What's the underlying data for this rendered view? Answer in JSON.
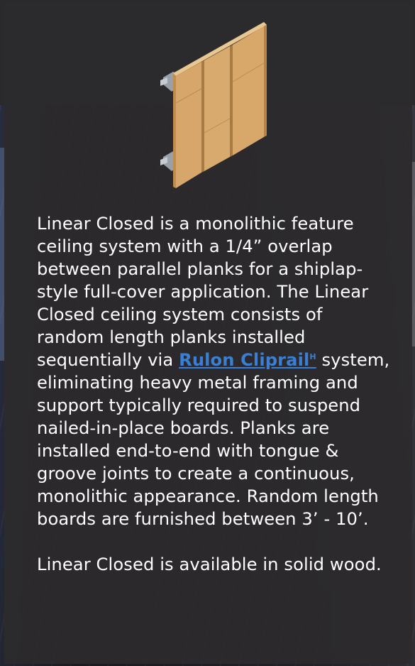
{
  "product": {
    "name": "Linear Closed",
    "image_icon": "wood-plank-panel-icon"
  },
  "description": {
    "para1_part1": "Linear Closed is a monolithic feature ceiling system with a 1/4” overlap between parallel planks for a shiplap-style full-cover application. The Linear Closed ceiling system consists of random length planks installed sequentially via ",
    "link_label": "Rulon Cliprail",
    "link_sup": "H",
    "para1_part2": " system, eliminating heavy metal framing and support typically required to suspend nailed-in-place boards. Planks are installed end-to-end with tongue & groove joints to create a continuous, monolithic appearance. Random length boards are furnished between 3’ - 10’.",
    "para2": "Linear Closed is available in solid wood."
  },
  "colors": {
    "background": "#2a292c",
    "text": "#ffffff",
    "link": "#3b7fd4",
    "wood": "#d7a86a"
  }
}
